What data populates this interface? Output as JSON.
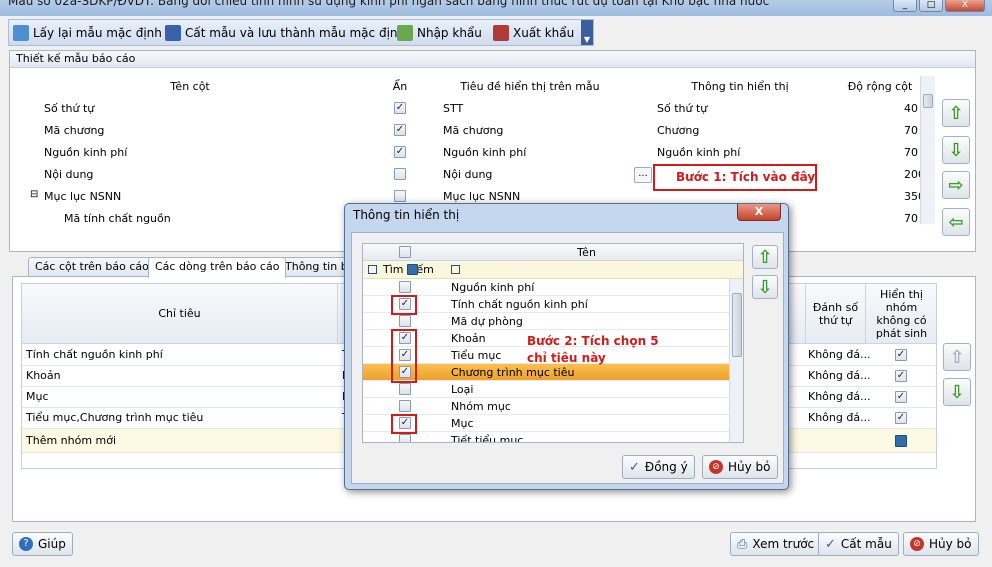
{
  "window": {
    "title": "Mẫu số 02a-SDKP/ĐVDT: Bảng đối chiếu tình hình sử dụng kinh phí ngân sách bằng hình thức rút dự toán tại Kho bạc nhà nước",
    "minimize": "_",
    "maximize": "□",
    "close": "X"
  },
  "toolbar": {
    "reset": "Lấy lại mẫu mặc định",
    "save_default": "Cất mẫu và lưu thành mẫu mặc định",
    "import": "Nhập khẩu",
    "export": "Xuất khẩu"
  },
  "design_panel": {
    "title": "Thiết kế mẫu báo cáo",
    "columns": [
      "Tên cột",
      "Ẩn",
      "Tiêu đề hiển thị trên mẫu",
      "Thông tin hiển thị",
      "Độ rộng cột"
    ],
    "rows": [
      {
        "name": "Số thứ tự",
        "hidden": true,
        "caption": "STT",
        "info": "Số thứ tự",
        "width": "40"
      },
      {
        "name": "Mã chương",
        "hidden": true,
        "caption": "Mã chương",
        "info": "Chương",
        "width": "70"
      },
      {
        "name": "Nguồn kinh phí",
        "hidden": true,
        "caption": "Nguồn kinh phí",
        "info": "Nguồn kinh phí",
        "width": "70"
      },
      {
        "name": "Nội dung",
        "hidden": false,
        "caption": "Nội dung",
        "info": "",
        "width": "200"
      },
      {
        "name": "Mục lục NSNN",
        "hidden": false,
        "caption": "Mục lục NSNN",
        "info": "",
        "width": "350"
      },
      {
        "name": "Mã tính chất nguồn",
        "hidden": false,
        "caption": "",
        "info": "",
        "width": "70"
      }
    ],
    "ellipsis": "...",
    "annotation": "Bước 1: Tích vào đây"
  },
  "tabs": [
    "Các cột trên báo cáo",
    "Các dòng trên báo cáo",
    "Thông tin bổ"
  ],
  "rows_panel": {
    "headers": {
      "indicator": "Chỉ tiêu",
      "numbering": "Đánh số thứ tự",
      "show_empty": "Hiển thị nhóm không có phát sinh"
    },
    "rows": [
      {
        "label": "Tính chất nguồn kinh phí",
        "prefix": "T",
        "numbering": "Không đá...",
        "checked": true
      },
      {
        "label": "Khoản",
        "prefix": "K",
        "numbering": "Không đá...",
        "checked": true
      },
      {
        "label": "Mục",
        "prefix": "M",
        "numbering": "Không đá...",
        "checked": true
      },
      {
        "label": "Tiểu mục,Chương trình mục tiêu",
        "prefix": "T",
        "numbering": "Không đá...",
        "checked": true
      }
    ],
    "new_group": "Thêm nhóm mới"
  },
  "dialog": {
    "title": "Thông tin hiển thị",
    "column": "Tên",
    "search": "Tìm kiếm",
    "annotation": "Bước 2: Tích chọn 5 chỉ tiêu này",
    "items": [
      {
        "label": "Nguồn kinh phí",
        "checked": false
      },
      {
        "label": "Tính chất nguồn kinh phí",
        "checked": true
      },
      {
        "label": "Mã dự phòng",
        "checked": false
      },
      {
        "label": "Khoản",
        "checked": true
      },
      {
        "label": "Tiểu mục",
        "checked": true
      },
      {
        "label": "Chương trình mục tiêu",
        "checked": true
      },
      {
        "label": "Loại",
        "checked": false
      },
      {
        "label": "Nhóm mục",
        "checked": false
      },
      {
        "label": "Mục",
        "checked": true
      },
      {
        "label": "Tiết tiểu mục",
        "checked": false
      }
    ],
    "ok": "Đồng ý",
    "cancel": "Hủy bỏ"
  },
  "footer": {
    "help": "Giúp",
    "preview": "Xem trước",
    "save": "Cất mẫu",
    "cancel": "Hủy bỏ"
  },
  "colors": {
    "accent": "#3c9b24",
    "annotation_red": "#d01c1c",
    "selected_row": "#f5b342"
  }
}
